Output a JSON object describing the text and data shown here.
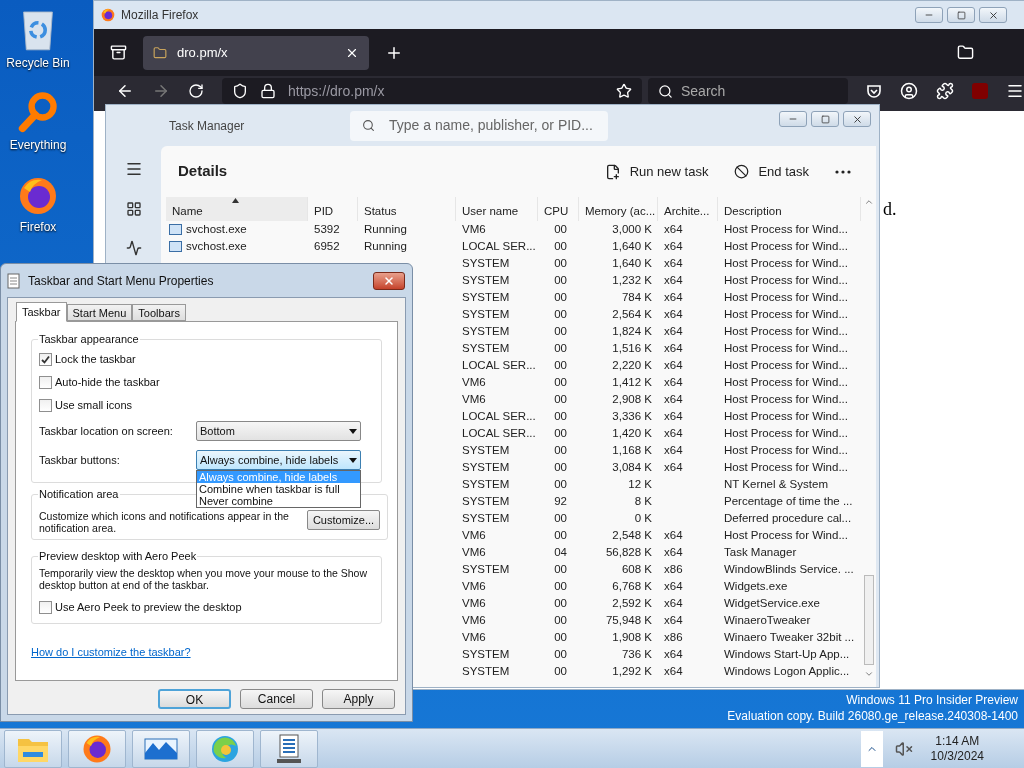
{
  "desktop_icons": [
    {
      "label": "Recycle Bin",
      "kind": "recycle"
    },
    {
      "label": "Everything",
      "kind": "magnifier"
    },
    {
      "label": "Firefox",
      "kind": "browser"
    }
  ],
  "firefox": {
    "title": "Mozilla Firefox",
    "tab": {
      "title": "dro.pm/x"
    },
    "url": "https://dro.pm/x",
    "search": {
      "placeholder": "Search"
    },
    "page_text": "d."
  },
  "task_manager": {
    "title": "Task Manager",
    "search": {
      "placeholder": "Type a name, publisher, or PID..."
    },
    "section": "Details",
    "actions": [
      {
        "label": "Run new task",
        "kind": "run"
      },
      {
        "label": "End task",
        "kind": "end"
      }
    ],
    "columns": [
      {
        "label": "Name",
        "sorted": true
      },
      {
        "label": "PID",
        "sorted": false
      },
      {
        "label": "Status",
        "sorted": false
      },
      {
        "label": "User name",
        "sorted": false
      },
      {
        "label": "CPU",
        "sorted": false
      },
      {
        "label": "Memory (ac...",
        "sorted": false
      },
      {
        "label": "Archite...",
        "sorted": false
      },
      {
        "label": "Description",
        "sorted": false
      }
    ],
    "rows": [
      {
        "name": "svchost.exe",
        "pid": "5392",
        "status": "Running",
        "user": "VM6",
        "cpu": "00",
        "memory": "3,000 K",
        "arch": "x64",
        "description": "Host Process for Wind..."
      },
      {
        "name": "svchost.exe",
        "pid": "6952",
        "status": "Running",
        "user": "LOCAL SER...",
        "cpu": "00",
        "memory": "1,640 K",
        "arch": "x64",
        "description": "Host Process for Wind..."
      },
      {
        "user": "SYSTEM",
        "cpu": "00",
        "memory": "1,640 K",
        "arch": "x64",
        "description": "Host Process for Wind..."
      },
      {
        "user": "SYSTEM",
        "cpu": "00",
        "memory": "1,232 K",
        "arch": "x64",
        "description": "Host Process for Wind..."
      },
      {
        "user": "SYSTEM",
        "cpu": "00",
        "memory": "784 K",
        "arch": "x64",
        "description": "Host Process for Wind..."
      },
      {
        "user": "SYSTEM",
        "cpu": "00",
        "memory": "2,564 K",
        "arch": "x64",
        "description": "Host Process for Wind..."
      },
      {
        "user": "SYSTEM",
        "cpu": "00",
        "memory": "1,824 K",
        "arch": "x64",
        "description": "Host Process for Wind..."
      },
      {
        "user": "SYSTEM",
        "cpu": "00",
        "memory": "1,516 K",
        "arch": "x64",
        "description": "Host Process for Wind..."
      },
      {
        "user": "LOCAL SER...",
        "cpu": "00",
        "memory": "2,220 K",
        "arch": "x64",
        "description": "Host Process for Wind..."
      },
      {
        "user": "VM6",
        "cpu": "00",
        "memory": "1,412 K",
        "arch": "x64",
        "description": "Host Process for Wind..."
      },
      {
        "user": "VM6",
        "cpu": "00",
        "memory": "2,908 K",
        "arch": "x64",
        "description": "Host Process for Wind..."
      },
      {
        "user": "LOCAL SER...",
        "cpu": "00",
        "memory": "3,336 K",
        "arch": "x64",
        "description": "Host Process for Wind..."
      },
      {
        "user": "LOCAL SER...",
        "cpu": "00",
        "memory": "1,420 K",
        "arch": "x64",
        "description": "Host Process for Wind..."
      },
      {
        "user": "SYSTEM",
        "cpu": "00",
        "memory": "1,168 K",
        "arch": "x64",
        "description": "Host Process for Wind..."
      },
      {
        "user": "SYSTEM",
        "cpu": "00",
        "memory": "3,084 K",
        "arch": "x64",
        "description": "Host Process for Wind..."
      },
      {
        "user": "SYSTEM",
        "cpu": "00",
        "memory": "12 K",
        "description": "NT Kernel & System"
      },
      {
        "user": "SYSTEM",
        "cpu": "92",
        "memory": "8 K",
        "description": "Percentage of time the ..."
      },
      {
        "user": "SYSTEM",
        "cpu": "00",
        "memory": "0 K",
        "description": "Deferred procedure cal..."
      },
      {
        "user": "VM6",
        "cpu": "00",
        "memory": "2,548 K",
        "arch": "x64",
        "description": "Host Process for Wind..."
      },
      {
        "user": "VM6",
        "cpu": "04",
        "memory": "56,828 K",
        "arch": "x64",
        "description": "Task Manager"
      },
      {
        "user": "SYSTEM",
        "cpu": "00",
        "memory": "608 K",
        "arch": "x86",
        "description": "WindowBlinds Service. ..."
      },
      {
        "user": "VM6",
        "cpu": "00",
        "memory": "6,768 K",
        "arch": "x64",
        "description": "Widgets.exe"
      },
      {
        "user": "VM6",
        "cpu": "00",
        "memory": "2,592 K",
        "arch": "x64",
        "description": "WidgetService.exe"
      },
      {
        "user": "VM6",
        "cpu": "00",
        "memory": "75,948 K",
        "arch": "x64",
        "description": "WinaeroTweaker"
      },
      {
        "user": "VM6",
        "cpu": "00",
        "memory": "1,908 K",
        "arch": "x86",
        "description": "Winaero Tweaker 32bit ..."
      },
      {
        "user": "SYSTEM",
        "cpu": "00",
        "memory": "736 K",
        "arch": "x64",
        "description": "Windows Start-Up App..."
      },
      {
        "user": "SYSTEM",
        "cpu": "00",
        "memory": "1,292 K",
        "arch": "x64",
        "description": "Windows Logon Applic..."
      }
    ]
  },
  "dialog": {
    "title": "Taskbar and Start Menu Properties",
    "tabs": [
      {
        "label": "Taskbar",
        "selected": true
      },
      {
        "label": "Start Menu",
        "selected": false
      },
      {
        "label": "Toolbars",
        "selected": false
      }
    ],
    "appearance": {
      "title": "Taskbar appearance",
      "checkboxes": [
        {
          "label": "Lock the taskbar",
          "checked": true
        },
        {
          "label": "Auto-hide the taskbar",
          "checked": false
        },
        {
          "label": "Use small icons",
          "checked": false
        }
      ],
      "location": {
        "label": "Taskbar location on screen:",
        "value": "Bottom"
      },
      "buttons_setting": {
        "label": "Taskbar buttons:",
        "value": "Always combine, hide labels",
        "expanded": true,
        "options": [
          {
            "label": "Always combine, hide labels",
            "selected": true
          },
          {
            "label": "Combine when taskbar is full",
            "selected": false
          },
          {
            "label": "Never combine",
            "selected": false
          }
        ]
      }
    },
    "notification": {
      "title": "Notification area",
      "text": "Customize which icons and notifications appear in the notification area.",
      "button": "Customize..."
    },
    "peek": {
      "title": "Preview desktop with Aero Peek",
      "text": "Temporarily view the desktop when you move your mouse to the Show desktop button at end of the taskbar.",
      "checkbox": {
        "label": "Use Aero Peek to preview the desktop",
        "checked": false
      }
    },
    "link": "How do I customize the taskbar?",
    "buttons": [
      {
        "label": "OK",
        "kind": "default"
      },
      {
        "label": "Cancel",
        "kind": "normal"
      },
      {
        "label": "Apply",
        "kind": "normal"
      }
    ]
  },
  "desktop_notice": [
    "Windows 11 Pro Insider Preview",
    "Evaluation copy. Build 26080.ge_release.240308-1400"
  ],
  "taskbar": {
    "apps": [
      {
        "kind": "folder"
      },
      {
        "kind": "browser"
      },
      {
        "kind": "mountains"
      },
      {
        "kind": "swirl"
      },
      {
        "kind": "monitor"
      }
    ],
    "clock": {
      "time": "1:14 AM",
      "date": "10/3/2024"
    }
  }
}
